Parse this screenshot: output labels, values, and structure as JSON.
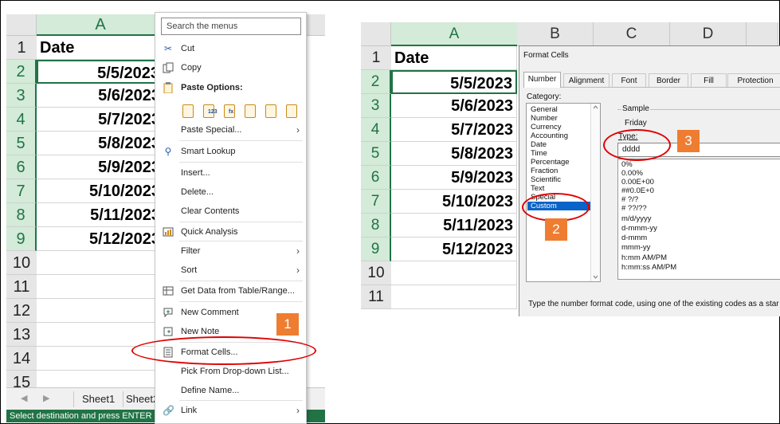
{
  "left_sheet": {
    "columns": [
      "A"
    ],
    "rows": [
      "1",
      "2",
      "3",
      "4",
      "5",
      "6",
      "7",
      "8",
      "9",
      "10",
      "11",
      "12",
      "13",
      "14",
      "15"
    ],
    "header_cell": "Date",
    "dates": [
      "5/5/2023",
      "5/6/2023",
      "5/7/2023",
      "5/8/2023",
      "5/9/2023",
      "5/10/2023",
      "5/11/2023",
      "5/12/2023"
    ],
    "sheet_tabs": [
      "Sheet1",
      "Sheet2"
    ],
    "status_text": "Select destination and press ENTER or ch"
  },
  "context_menu": {
    "search_placeholder": "Search the menus",
    "items": {
      "cut": "Cut",
      "copy": "Copy",
      "paste_options": "Paste Options:",
      "paste_special": "Paste Special...",
      "smart_lookup": "Smart Lookup",
      "insert": "Insert...",
      "delete": "Delete...",
      "clear_contents": "Clear Contents",
      "quick_analysis": "Quick Analysis",
      "filter": "Filter",
      "sort": "Sort",
      "get_data": "Get Data from Table/Range...",
      "new_comment": "New Comment",
      "new_note": "New Note",
      "format_cells": "Format Cells...",
      "pick_list": "Pick From Drop-down List...",
      "define_name": "Define Name...",
      "link": "Link"
    },
    "paste_icon_tags": [
      "",
      "123",
      "fx",
      "",
      "",
      ""
    ]
  },
  "right_sheet": {
    "columns": [
      "A",
      "B",
      "C",
      "D"
    ],
    "rows": [
      "1",
      "2",
      "3",
      "4",
      "5",
      "6",
      "7",
      "8",
      "9",
      "10",
      "11"
    ],
    "header_cell": "Date",
    "dates": [
      "5/5/2023",
      "5/6/2023",
      "5/7/2023",
      "5/8/2023",
      "5/9/2023",
      "5/10/2023",
      "5/11/2023",
      "5/12/2023"
    ]
  },
  "dialog": {
    "title": "Format Cells",
    "tabs": [
      "Number",
      "Alignment",
      "Font",
      "Border",
      "Fill",
      "Protection"
    ],
    "category_label": "Category:",
    "categories": [
      "General",
      "Number",
      "Currency",
      "Accounting",
      "Date",
      "Time",
      "Percentage",
      "Fraction",
      "Scientific",
      "Text",
      "Special",
      "Custom"
    ],
    "selected_category": "Custom",
    "sample_label": "Sample",
    "sample_value": "Friday",
    "type_label": "Type:",
    "type_value": "dddd",
    "codes": [
      "0%",
      "0.00%",
      "0.00E+00",
      "##0.0E+0",
      "# ?/?",
      "# ??/??",
      "m/d/yyyy",
      "d-mmm-yy",
      "d-mmm",
      "mmm-yy",
      "h:mm AM/PM",
      "h:mm:ss AM/PM"
    ],
    "footer_text": "Type the number format code, using one of the existing codes as a star"
  },
  "annotations": {
    "step1": "1",
    "step2": "2",
    "step3": "3",
    "circle_color": "#e00000",
    "badge_color": "#ee7d31"
  },
  "colors": {
    "excel_green": "#217346",
    "selected_header": "#d3ebd8",
    "selection_blue": "#0a63c9"
  }
}
